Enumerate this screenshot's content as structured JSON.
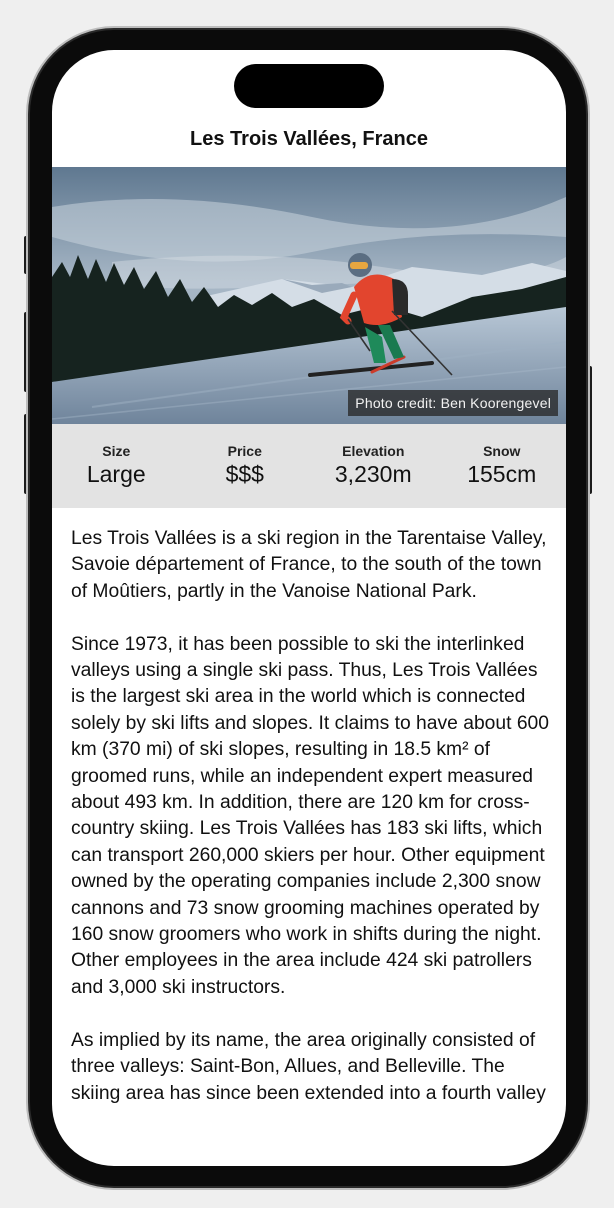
{
  "nav": {
    "title": "Les Trois Vallées, France"
  },
  "hero": {
    "photo_credit": "Photo credit: Ben Koorengevel"
  },
  "stats": [
    {
      "label": "Size",
      "value": "Large"
    },
    {
      "label": "Price",
      "value": "$$$"
    },
    {
      "label": "Elevation",
      "value": "3,230m"
    },
    {
      "label": "Snow",
      "value": "155cm"
    }
  ],
  "description": [
    "Les Trois Vallées is a ski region in the Tarentaise Valley, Savoie département of France, to the south of the town of Moûtiers, partly in the Vanoise National Park.",
    "Since 1973, it has been possible to ski the interlinked valleys using a single ski pass. Thus, Les Trois Vallées is the largest ski area in the world which is connected solely by ski lifts and slopes. It claims to have about 600 km (370 mi) of ski slopes, resulting in 18.5 km² of groomed runs, while an independent expert measured about 493 km. In addition, there are 120 km for cross-country skiing. Les Trois Vallées has 183 ski lifts, which can transport 260,000 skiers per hour. Other equipment owned by the operating companies include 2,300 snow cannons and 73 snow grooming machines operated by 160 snow groomers who work in shifts during the night. Other employees in the area include 424 ski patrollers and 3,000 ski instructors.",
    "As implied by its name, the area originally consisted of three valleys: Saint-Bon, Allues, and Belleville. The skiing area has since been extended into a fourth valley"
  ]
}
